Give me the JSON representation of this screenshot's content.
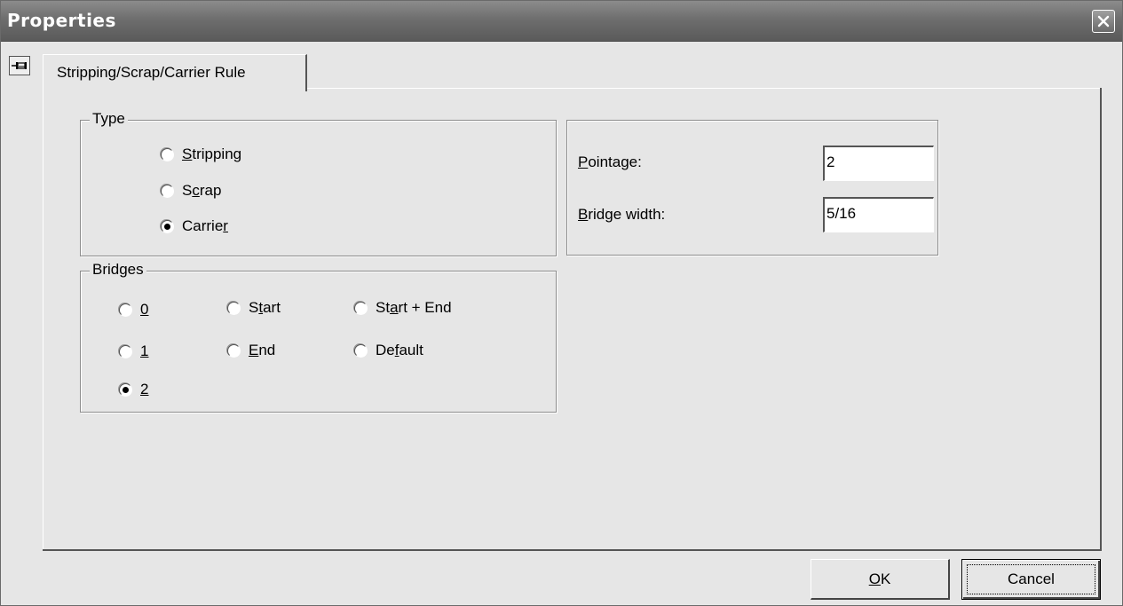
{
  "window": {
    "title": "Properties"
  },
  "tabs": [
    {
      "label": "Stripping/Scrap/Carrier Rule",
      "selected": true
    }
  ],
  "type_group": {
    "legend": "Type",
    "options": [
      {
        "prefix": "",
        "mnemonic": "S",
        "suffix": "tripping",
        "checked": false
      },
      {
        "prefix": "S",
        "mnemonic": "c",
        "suffix": "rap",
        "checked": false
      },
      {
        "prefix": "Carrie",
        "mnemonic": "r",
        "suffix": "",
        "checked": true
      }
    ]
  },
  "bridges_group": {
    "legend": "Bridges",
    "options": [
      {
        "prefix": "",
        "mnemonic": "0",
        "suffix": "",
        "checked": false
      },
      {
        "prefix": "S",
        "mnemonic": "t",
        "suffix": "art",
        "checked": false
      },
      {
        "prefix": "St",
        "mnemonic": "a",
        "suffix": "rt + End",
        "checked": false
      },
      {
        "prefix": "",
        "mnemonic": "1",
        "suffix": "",
        "checked": false
      },
      {
        "prefix": "",
        "mnemonic": "E",
        "suffix": "nd",
        "checked": false
      },
      {
        "prefix": "De",
        "mnemonic": "f",
        "suffix": "ault",
        "checked": false
      },
      {
        "prefix": "",
        "mnemonic": "2",
        "suffix": "",
        "checked": true
      }
    ]
  },
  "fields": {
    "pointage": {
      "label_mnemonic": "P",
      "label_rest": "ointage:",
      "value": "2"
    },
    "bridge_width": {
      "label_mnemonic": "B",
      "label_rest": "ridge width:",
      "value": "5/16"
    }
  },
  "buttons": {
    "ok": {
      "mnemonic": "O",
      "rest": "K"
    },
    "cancel": {
      "label": "Cancel"
    }
  }
}
